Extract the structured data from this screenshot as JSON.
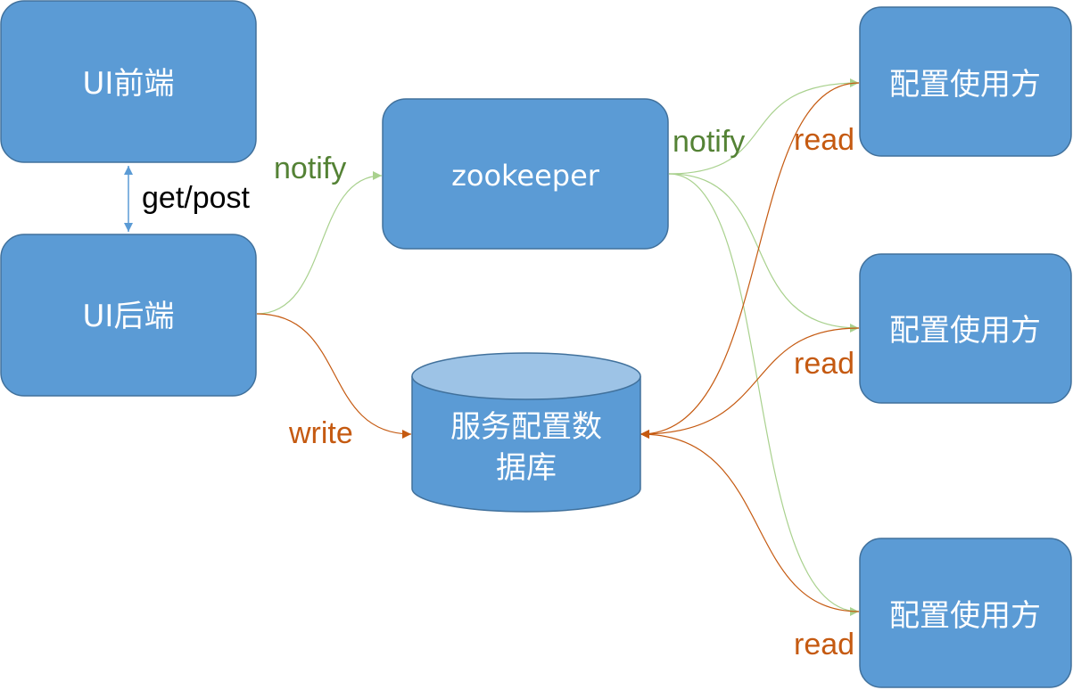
{
  "nodes": {
    "ui_frontend": "UI前端",
    "ui_backend": "UI后端",
    "zookeeper": "zookeeper",
    "database_line1": "服务配置数",
    "database_line2": "据库",
    "consumer_1": "配置使用方",
    "consumer_2": "配置使用方",
    "consumer_3": "配置使用方"
  },
  "edges": {
    "get_post": "get/post",
    "notify_backend_to_zk": "notify",
    "notify_zk_to_consumers": "notify",
    "write": "write",
    "read_1": "read",
    "read_2": "read",
    "read_3": "read"
  },
  "colors": {
    "node_fill": "#5B9BD5",
    "node_stroke": "#41719C",
    "db_top": "#9DC3E6",
    "notify_green": "#548235",
    "notify_line": "#A9D18E",
    "orange": "#C55A11",
    "blue_arrow": "#5B9BD5",
    "text_black": "#000000"
  }
}
